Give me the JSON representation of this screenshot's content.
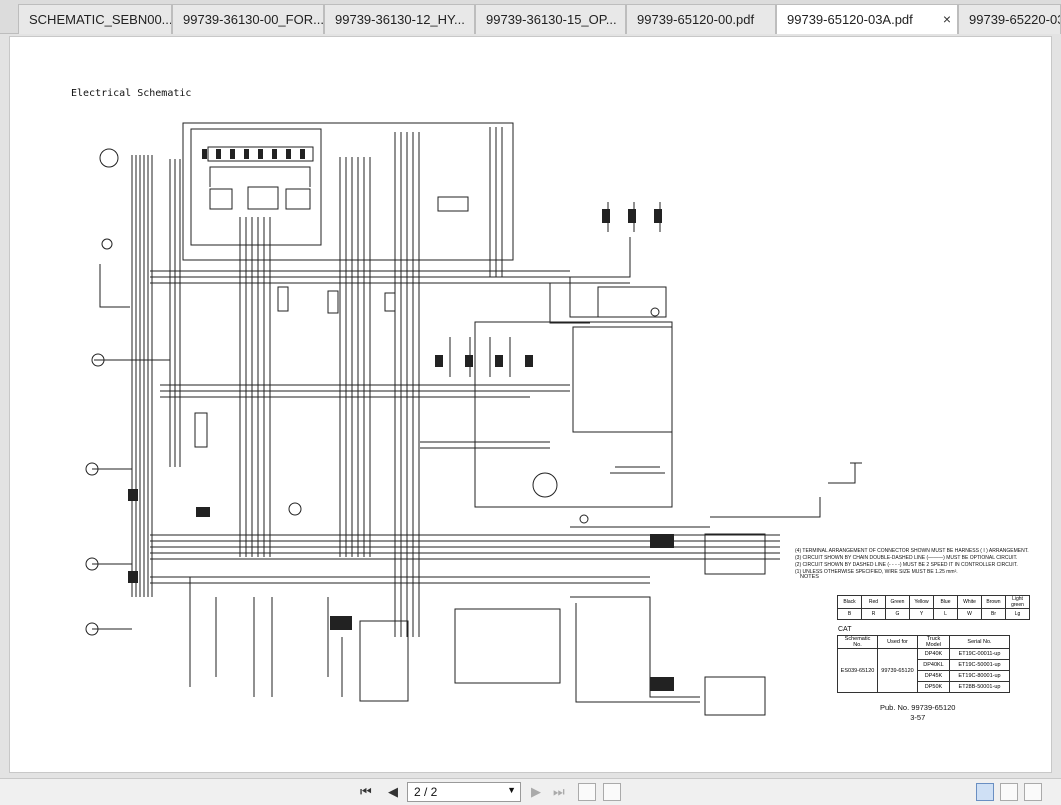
{
  "tabs": [
    {
      "label": "SCHEMATIC_SEBN00...",
      "active": false
    },
    {
      "label": "99739-36130-00_FOR...",
      "active": false
    },
    {
      "label": "99739-36130-12_HY...",
      "active": false
    },
    {
      "label": "99739-36130-15_OP...",
      "active": false
    },
    {
      "label": "99739-65120-00.pdf",
      "active": false
    },
    {
      "label": "99739-65120-03A.pdf",
      "active": true
    },
    {
      "label": "99739-65220-03",
      "active": false
    }
  ],
  "close_glyph": "×",
  "document": {
    "title": "Electrical Schematic",
    "notes": [
      "(4) TERMINAL ARRANGEMENT OF CONNECTOR SHOWN MUST BE HARNESS ( I ) ARRANGEMENT.",
      "(3) CIRCUIT SHOWN BY CHAIN DOUBLE-DASHED LINE (———) MUST BE OPTIONAL CIRCUIT.",
      "(2) CIRCUIT SHOWN BY DASHED LINE (- - - -) MUST BE 2 SPEED IT IN CONTROLLER CIRCUIT.",
      "(1) UNLESS OTHERWISE SPECIFIED, WIRE SIZE MUST BE 1.25 mm²."
    ],
    "notes_label": "NOTES",
    "wire_colors": {
      "names": [
        "Black",
        "Red",
        "Green",
        "Yellow",
        "Blue",
        "White",
        "Brown",
        "Light green"
      ],
      "codes": [
        "B",
        "R",
        "G",
        "Y",
        "L",
        "W",
        "Br",
        "Lg"
      ]
    },
    "brand": "CAT",
    "model_table": {
      "headers": [
        "Schematic No.",
        "Used for",
        "Truck Model",
        "Serial No."
      ],
      "schematic_no": "ES039-65120",
      "used_for": "99739-65120",
      "rows": [
        {
          "model": "DP40K",
          "serial": "ET19C-00011-up"
        },
        {
          "model": "DP40KL",
          "serial": "ET19C-50001-up"
        },
        {
          "model": "DP45K",
          "serial": "ET19C-80001-up"
        },
        {
          "model": "DP50K",
          "serial": "ET28B-50001-up"
        }
      ]
    },
    "pub_no": "Pub. No. 99739-65120",
    "page_ref": "3-57"
  },
  "toolbar": {
    "page_value": "2 / 2",
    "first_glyph": "⏮",
    "prev_glyph": "◀",
    "next_glyph": "▶",
    "last_glyph": "⏭"
  }
}
